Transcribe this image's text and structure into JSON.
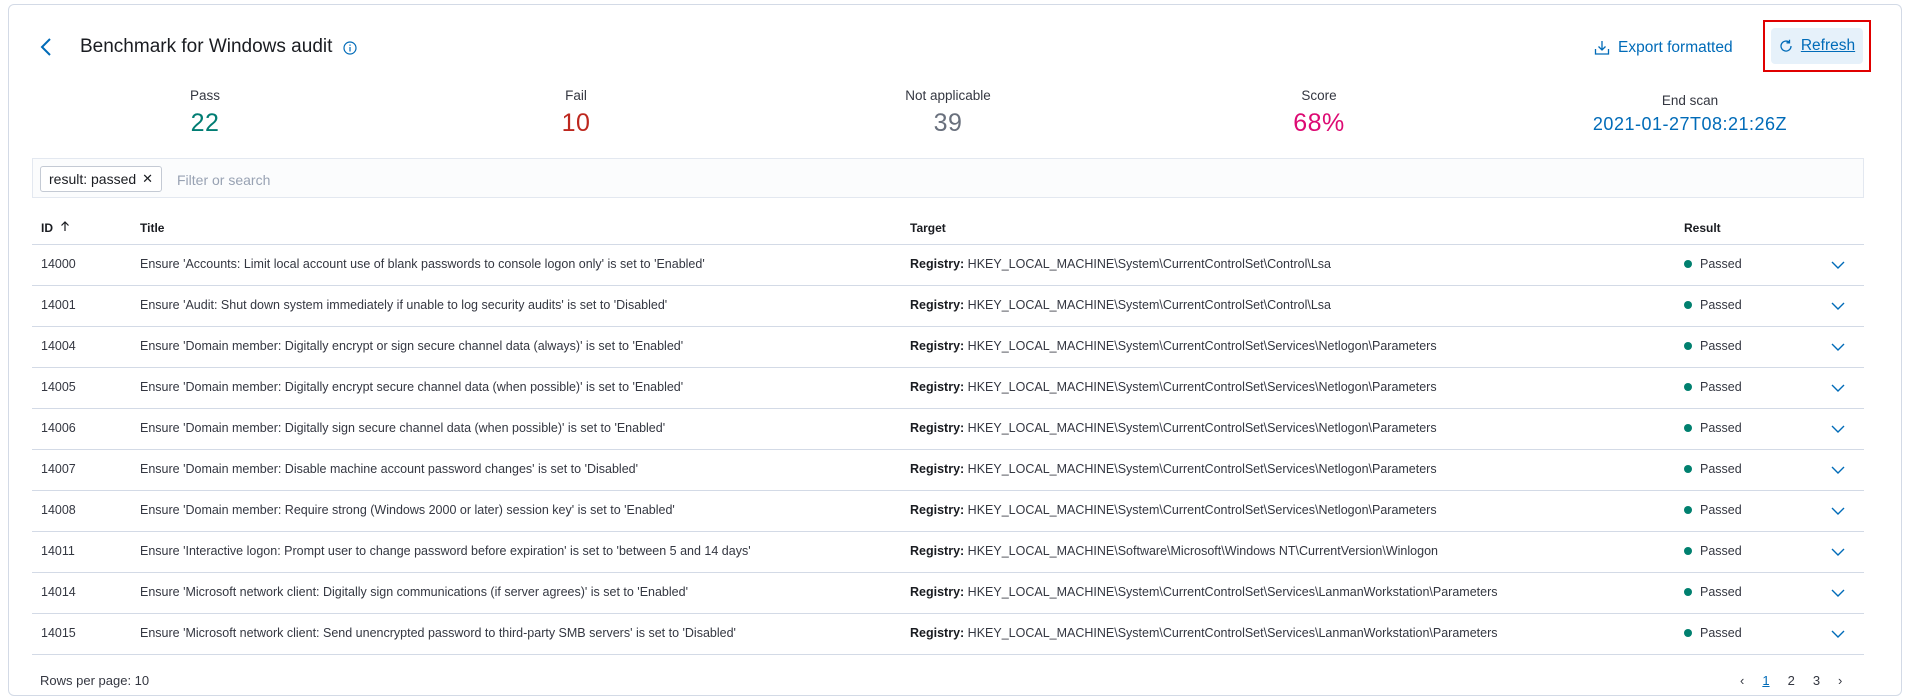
{
  "header": {
    "title": "Benchmark for Windows audit",
    "export_label": "Export formatted",
    "refresh_label": "Refresh"
  },
  "stats": {
    "pass": {
      "label": "Pass",
      "value": "22",
      "color": "#017d73"
    },
    "fail": {
      "label": "Fail",
      "value": "10",
      "color": "#bd271e"
    },
    "not_applicable": {
      "label": "Not applicable",
      "value": "39",
      "color": "#69707d"
    },
    "score": {
      "label": "Score",
      "value": "68%",
      "color": "#dd0a73"
    },
    "end_scan": {
      "label": "End scan",
      "value": "2021-01-27T08:21:26Z",
      "color": "#006bb8"
    }
  },
  "search": {
    "filter_pill": "result: passed",
    "placeholder": "Filter or search"
  },
  "table": {
    "columns": {
      "id": "ID",
      "title": "Title",
      "target": "Target",
      "result": "Result"
    },
    "rows": [
      {
        "id": "14000",
        "title": "Ensure 'Accounts: Limit local account use of blank passwords to console logon only' is set to 'Enabled'",
        "target_key": "Registry:",
        "target_value": "HKEY_LOCAL_MACHINE\\System\\CurrentControlSet\\Control\\Lsa",
        "result": "Passed"
      },
      {
        "id": "14001",
        "title": "Ensure 'Audit: Shut down system immediately if unable to log security audits' is set to 'Disabled'",
        "target_key": "Registry:",
        "target_value": "HKEY_LOCAL_MACHINE\\System\\CurrentControlSet\\Control\\Lsa",
        "result": "Passed"
      },
      {
        "id": "14004",
        "title": "Ensure 'Domain member: Digitally encrypt or sign secure channel data (always)' is set to 'Enabled'",
        "target_key": "Registry:",
        "target_value": "HKEY_LOCAL_MACHINE\\System\\CurrentControlSet\\Services\\Netlogon\\Parameters",
        "result": "Passed"
      },
      {
        "id": "14005",
        "title": "Ensure 'Domain member: Digitally encrypt secure channel data (when possible)' is set to 'Enabled'",
        "target_key": "Registry:",
        "target_value": "HKEY_LOCAL_MACHINE\\System\\CurrentControlSet\\Services\\Netlogon\\Parameters",
        "result": "Passed"
      },
      {
        "id": "14006",
        "title": "Ensure 'Domain member: Digitally sign secure channel data (when possible)' is set to 'Enabled'",
        "target_key": "Registry:",
        "target_value": "HKEY_LOCAL_MACHINE\\System\\CurrentControlSet\\Services\\Netlogon\\Parameters",
        "result": "Passed"
      },
      {
        "id": "14007",
        "title": "Ensure 'Domain member: Disable machine account password changes' is set to 'Disabled'",
        "target_key": "Registry:",
        "target_value": "HKEY_LOCAL_MACHINE\\System\\CurrentControlSet\\Services\\Netlogon\\Parameters",
        "result": "Passed"
      },
      {
        "id": "14008",
        "title": "Ensure 'Domain member: Require strong (Windows 2000 or later) session key' is set to 'Enabled'",
        "target_key": "Registry:",
        "target_value": "HKEY_LOCAL_MACHINE\\System\\CurrentControlSet\\Services\\Netlogon\\Parameters",
        "result": "Passed"
      },
      {
        "id": "14011",
        "title": "Ensure 'Interactive logon: Prompt user to change password before expiration' is set to 'between 5 and 14 days'",
        "target_key": "Registry:",
        "target_value": "HKEY_LOCAL_MACHINE\\Software\\Microsoft\\Windows NT\\CurrentVersion\\Winlogon",
        "result": "Passed"
      },
      {
        "id": "14014",
        "title": "Ensure 'Microsoft network client: Digitally sign communications (if server agrees)' is set to 'Enabled'",
        "target_key": "Registry:",
        "target_value": "HKEY_LOCAL_MACHINE\\System\\CurrentControlSet\\Services\\LanmanWorkstation\\Parameters",
        "result": "Passed"
      },
      {
        "id": "14015",
        "title": "Ensure 'Microsoft network client: Send unencrypted password to third-party SMB servers' is set to 'Disabled'",
        "target_key": "Registry:",
        "target_value": "HKEY_LOCAL_MACHINE\\System\\CurrentControlSet\\Services\\LanmanWorkstation\\Parameters",
        "result": "Passed"
      }
    ]
  },
  "footer": {
    "rows_per_page": "Rows per page: 10",
    "pages": [
      "1",
      "2",
      "3"
    ]
  },
  "colors": {
    "accent": "#006bb8",
    "passed_dot": "#00806f",
    "highlight_border": "#e00000"
  }
}
